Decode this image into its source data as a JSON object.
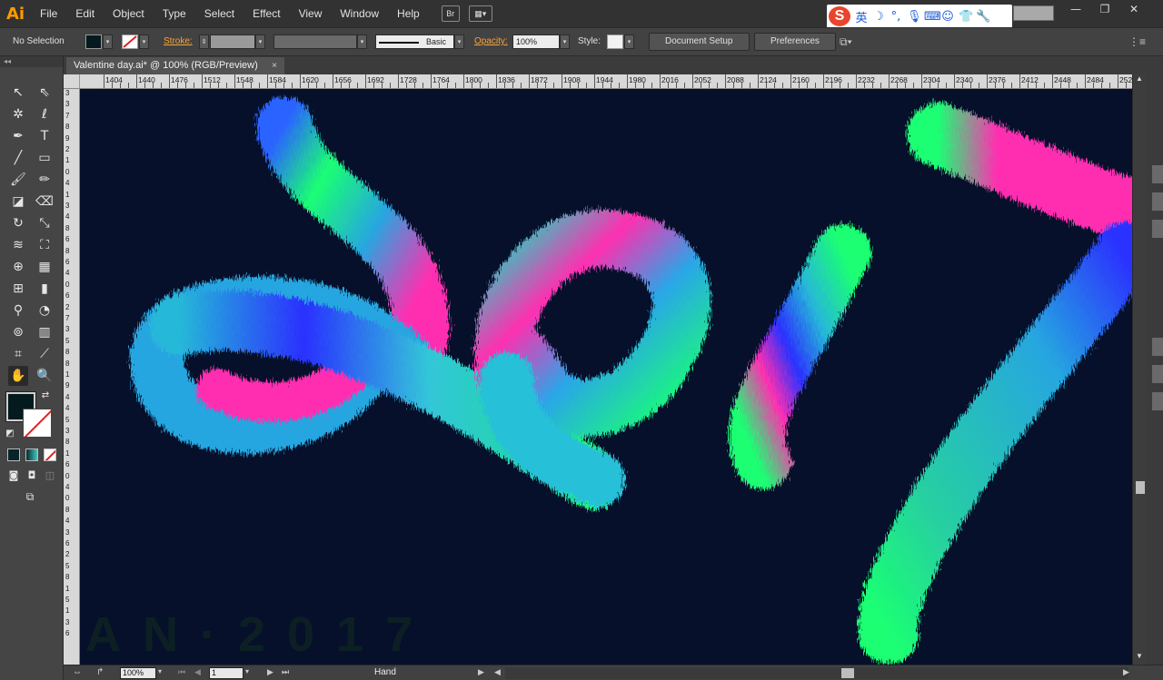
{
  "app": {
    "logo": "Ai"
  },
  "menu": [
    "File",
    "Edit",
    "Object",
    "Type",
    "Select",
    "Effect",
    "View",
    "Window",
    "Help"
  ],
  "menubar_buttons": {
    "bridge": "Br"
  },
  "ime": {
    "badge": "S",
    "lang": "英"
  },
  "control": {
    "selection": "No Selection",
    "stroke_label": "Stroke:",
    "brush": "Basic",
    "opacity_label": "Opacity:",
    "opacity_value": "100%",
    "style_label": "Style:",
    "document_setup": "Document Setup",
    "preferences": "Preferences"
  },
  "document_tab": {
    "title": "Valentine day.ai* @ 100% (RGB/Preview)",
    "close": "×"
  },
  "toolbox": {
    "collapse": "◂◂"
  },
  "ruler": {
    "marks": [
      "1404",
      "1440",
      "1476",
      "1512",
      "1548",
      "1584",
      "1620",
      "1656",
      "1692",
      "1728",
      "1764",
      "1800",
      "1836",
      "1872",
      "1908",
      "1944",
      "1980",
      "2016",
      "2052",
      "2088",
      "2124",
      "2160",
      "2196",
      "2232",
      "2268",
      "2304",
      "2340",
      "2376",
      "2412",
      "2448",
      "2484",
      "2520",
      "25"
    ],
    "vertical_digits": [
      "3",
      "3",
      "7",
      "8",
      "9",
      "2",
      "1",
      "0",
      "4",
      "1",
      "3",
      "4",
      "8",
      "6",
      "8",
      "6",
      "4",
      "0",
      "6",
      "2",
      "7",
      "3",
      "5",
      "8",
      "8",
      "1",
      "9",
      "4",
      "4",
      "5",
      "3",
      "8",
      "1",
      "6",
      "0",
      "4",
      "0",
      "8",
      "4",
      "3",
      "6",
      "2",
      "5",
      "8",
      "1",
      "5",
      "1",
      "3",
      "6"
    ]
  },
  "canvas": {
    "background": "#06102a",
    "watermark": "AN·2017",
    "palette": {
      "pink": "#ff2fb0",
      "green": "#1aff73",
      "cyan": "#27a6e0",
      "blue": "#2a30ff"
    }
  },
  "status": {
    "zoom": "100%",
    "page": "1",
    "tool": "Hand"
  }
}
